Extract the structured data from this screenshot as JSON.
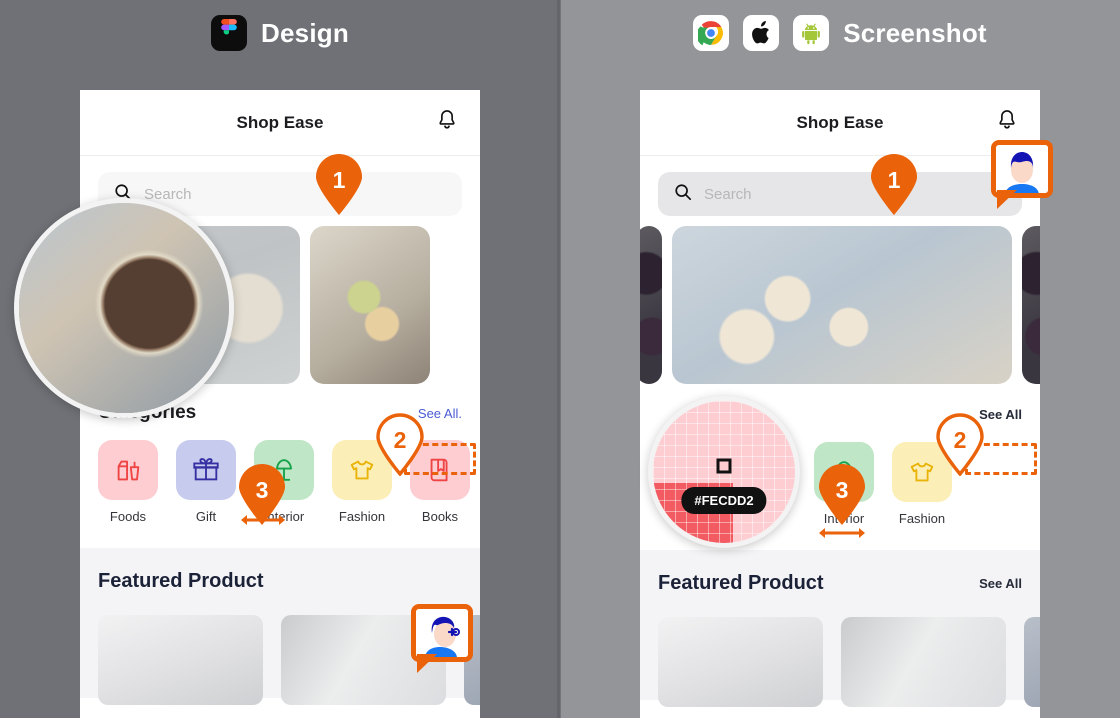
{
  "headers": {
    "left": {
      "title": "Design",
      "icons": [
        {
          "name": "figma-icon",
          "label": "Figma"
        }
      ]
    },
    "right": {
      "title": "Screenshot",
      "icons": [
        {
          "name": "chrome-icon",
          "label": "Chrome"
        },
        {
          "name": "apple-icon",
          "label": "Apple"
        },
        {
          "name": "android-icon",
          "label": "Android"
        }
      ]
    }
  },
  "app": {
    "title": "Shop Ease",
    "notification_icon": "bell-icon",
    "search": {
      "placeholder": "Search",
      "icon": "search-icon"
    },
    "categories_heading": "Categories",
    "see_all_design": "See All.",
    "see_all_screenshot": "See All",
    "categories": [
      {
        "label": "Foods",
        "icon": "milk-carton-icon",
        "bg": "#FECDD2",
        "fg": "#ef4444"
      },
      {
        "label": "Gift",
        "icon": "gift-icon",
        "bg": "#C7CBEE",
        "fg": "#3730a3"
      },
      {
        "label": "Interior",
        "icon": "lamp-icon",
        "bg": "#BFE6C6",
        "fg": "#16a34a"
      },
      {
        "label": "Fashion",
        "icon": "tshirt-icon",
        "bg": "#FBEFB7",
        "fg": "#eab308"
      },
      {
        "label": "Books",
        "icon": "book-icon",
        "bg": "#FECDD2",
        "fg": "#ef4444"
      }
    ],
    "featured_heading": "Featured Product",
    "featured_see_all": "See All"
  },
  "annotations": {
    "markers": [
      {
        "id": "1",
        "style": "filled"
      },
      {
        "id": "2",
        "style": "outline"
      },
      {
        "id": "3",
        "style": "filled"
      }
    ],
    "color_picker": {
      "hex": "#FECDD2",
      "swatch": "#FECDD2"
    }
  },
  "colors": {
    "accent_orange": "#EA6209",
    "panel_left_bg": "#6F7176",
    "panel_right_bg": "#949599",
    "link_blue": "#4A5BD4"
  }
}
